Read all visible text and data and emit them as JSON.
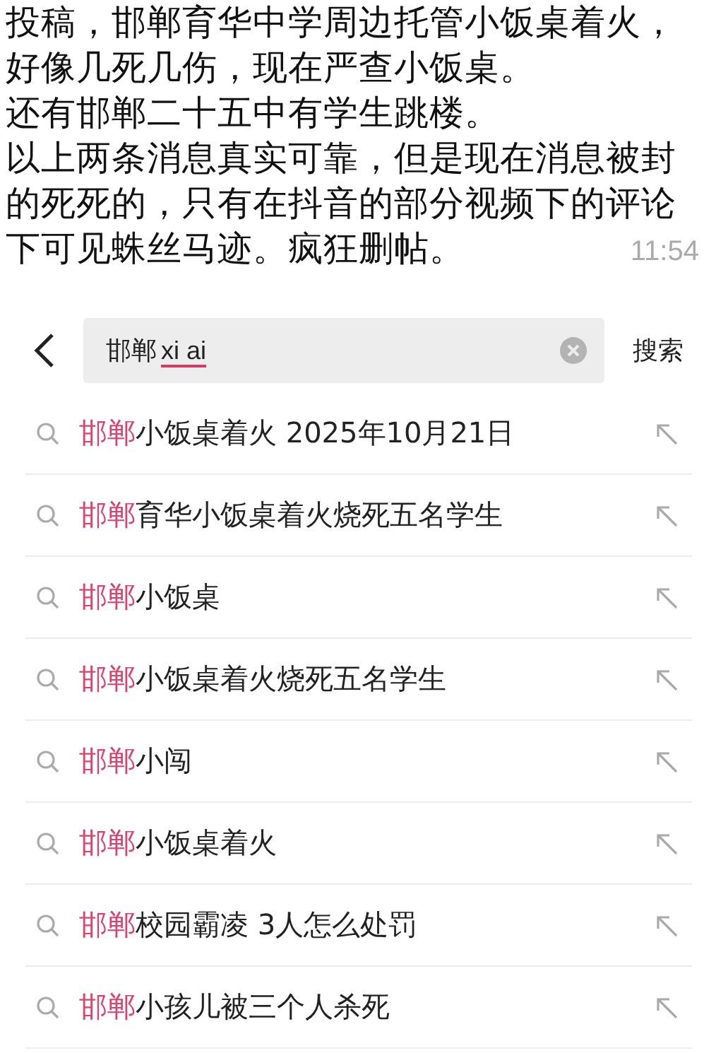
{
  "message": {
    "lines": [
      "投稿，邯郸育华中学周边托管小饭桌着火，",
      "好像几死几伤，现在严查小饭桌。",
      "还有邯郸二十五中有学生跳楼。",
      "以上两条消息真实可靠，但是现在消息被封",
      "的死死的，只有在抖音的部分视频下的评论",
      "下可见蛛丝马迹。疯狂删帖。"
    ],
    "time": "11:54"
  },
  "search": {
    "query": "邯郸",
    "composing": "xi ai",
    "button": "搜索"
  },
  "suggestions": [
    {
      "match": "邯郸",
      "rest": "小饭桌着火 2025年10月21日"
    },
    {
      "match": "邯郸",
      "rest": "育华小饭桌着火烧死五名学生"
    },
    {
      "match": "邯郸",
      "rest": "小饭桌"
    },
    {
      "match": "邯郸",
      "rest": "小饭桌着火烧死五名学生"
    },
    {
      "match": "邯郸",
      "rest": "小闯"
    },
    {
      "match": "邯郸",
      "rest": "小饭桌着火"
    },
    {
      "match": "邯郸",
      "rest": "校园霸凌 3人怎么处罚"
    },
    {
      "match": "邯郸",
      "rest": "小孩儿被三个人杀死"
    }
  ]
}
